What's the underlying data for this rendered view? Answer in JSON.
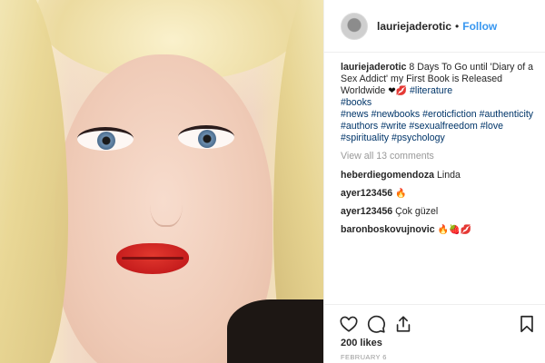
{
  "post": {
    "author": "lauriejaderotic",
    "follow_label": "Follow",
    "separator": "•",
    "caption": {
      "author": "lauriejaderotic",
      "text": "8 Days To Go until 'Diary of a Sex Addict' my First Book is Released Worldwide",
      "emojis": [
        "❤",
        "💋"
      ],
      "hashtags": [
        "#literature",
        "#books",
        "#news",
        "#newbooks",
        "#eroticfiction",
        "#authenticity",
        "#authors",
        "#write",
        "#sexualfreedom",
        "#love",
        "#spirituality",
        "#psychology"
      ]
    },
    "view_all_label": "View all 13 comments",
    "comments": [
      {
        "user": "heberdiegomendoza",
        "text": "Linda",
        "emoji": ""
      },
      {
        "user": "ayer123456",
        "text": "",
        "emoji": "🔥"
      },
      {
        "user": "ayer123456",
        "text": "Çok güzel",
        "emoji": ""
      },
      {
        "user": "baronboskovujnovic",
        "text": "",
        "emoji": "🔥🍓💋"
      }
    ],
    "likes": "200 likes",
    "date": "FEBRUARY 6"
  },
  "icons": {
    "like": "heart-outline-icon",
    "comment": "speech-bubble-icon",
    "share": "share-arrow-icon",
    "save": "bookmark-icon"
  },
  "colors": {
    "link": "#3897f0",
    "hashtag": "#003569",
    "muted": "#999999",
    "text": "#262626",
    "lipstick": "#c61d1d"
  }
}
